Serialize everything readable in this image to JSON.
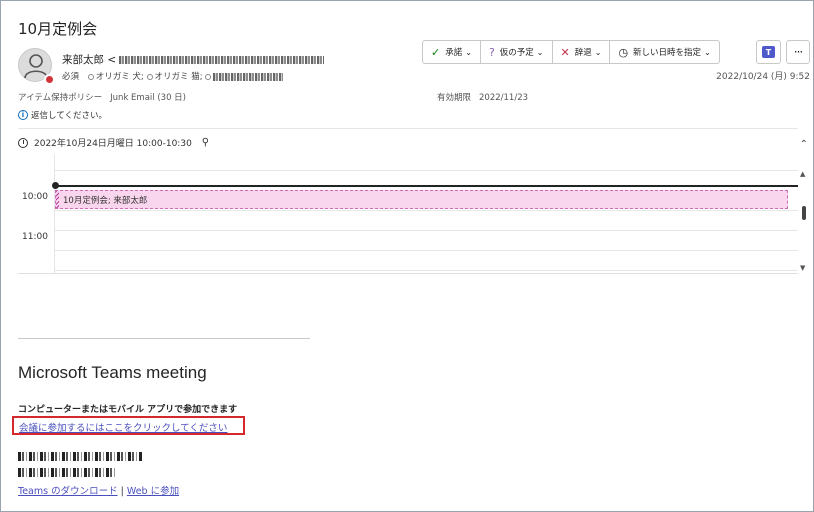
{
  "subject": "10月定例会",
  "sender": {
    "name": "来部太郎"
  },
  "recipients": {
    "required_label": "必須",
    "attendees": [
      "オリガミ 犬;",
      "オリガミ 猫;"
    ]
  },
  "actions": [
    {
      "icon": "checkmark-icon",
      "label": "承諾"
    },
    {
      "icon": "question-icon",
      "label": "仮の予定"
    },
    {
      "icon": "x-icon",
      "label": "辞退"
    },
    {
      "icon": "clock-icon",
      "label": "新しい日時を指定"
    }
  ],
  "received_date": "2022/10/24 (月) 9:52",
  "retention": {
    "label": "アイテム保持ポリシー",
    "value": "Junk Email (30 日)"
  },
  "expires": {
    "label": "有効期限",
    "value": "2022/11/23"
  },
  "notice": "返信してください。",
  "meeting_time": "2022年10月24日月曜日 10:00-10:30",
  "calendar": {
    "hours": [
      "10:00",
      "11:00"
    ],
    "event_label": "10月定例会; 来部太郎"
  },
  "teams": {
    "title": "Microsoft Teams meeting",
    "join_hint": "コンピューターまたはモバイル アプリで参加できます",
    "join_link": "会議に参加するにはここをクリックしてください",
    "download_link": "Teams のダウンロード",
    "separator": "|",
    "web_join_link": "Web に参加"
  },
  "colors": {
    "accent": "#4a4fbd",
    "highlight_border": "#d4282d",
    "event_bg": "#f9d6ee",
    "presence_busy": "#d13438"
  }
}
